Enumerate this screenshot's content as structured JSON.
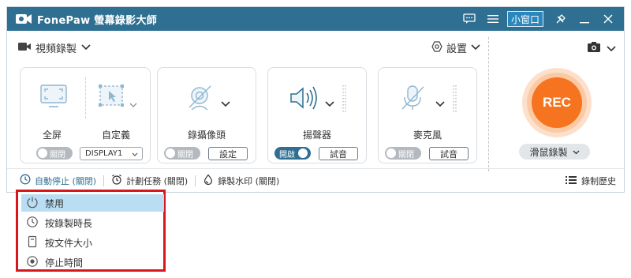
{
  "app": {
    "title": "FonePaw 螢幕錄影大師"
  },
  "titlebar": {
    "mini_window_label": "小窗口"
  },
  "recorder": {
    "mode_label": "視頻錄製",
    "settings_label": "設置",
    "screen": {
      "fullscreen_label": "全屏",
      "custom_label": "自定義",
      "toggle_label": "關閉",
      "display_value": "DISPLAY1"
    },
    "webcam": {
      "name": "錄攝像頭",
      "toggle_label": "關閉",
      "button_label": "設定"
    },
    "speaker": {
      "name": "揚聲器",
      "toggle_label": "開啟",
      "button_label": "試音"
    },
    "mic": {
      "name": "麥克風",
      "toggle_label": "關閉",
      "button_label": "試音"
    },
    "rec_label": "REC",
    "mouse_record_label": "滑鼠錄製"
  },
  "bottombar": {
    "auto_stop": "自動停止 (關閉)",
    "schedule": "計劃任務 (關閉)",
    "watermark": "錄製水印 (關閉)",
    "history": "錄制歷史"
  },
  "dropdown": {
    "items": [
      "禁用",
      "按錄製時長",
      "按文件大小",
      "停止時間"
    ],
    "selected_index": 0
  },
  "colors": {
    "titlebar": "#2f6f92",
    "accent": "#2f6f92",
    "rec": "#f6731f",
    "highlight_border": "#d9161b"
  }
}
